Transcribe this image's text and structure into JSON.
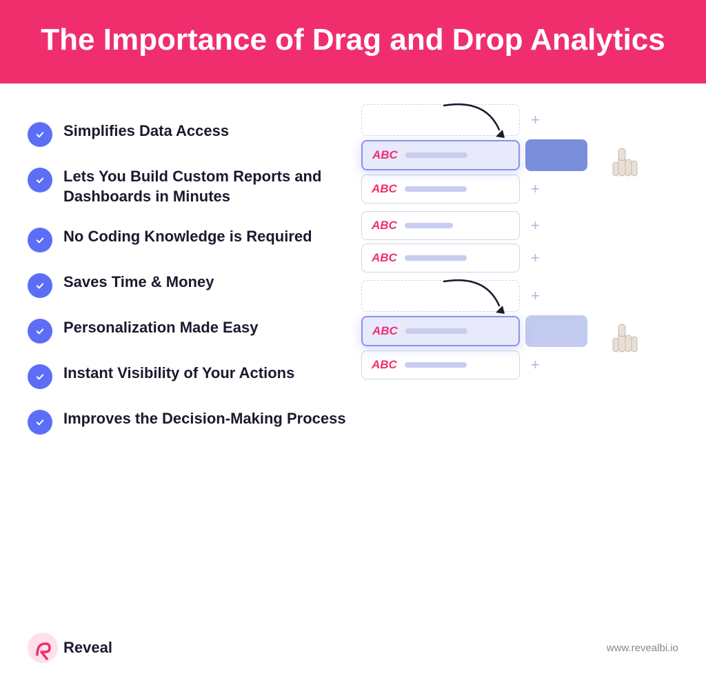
{
  "header": {
    "title": "The Importance of Drag and Drop Analytics"
  },
  "checklist": {
    "items": [
      {
        "id": "item1",
        "text": "Simplifies Data Access"
      },
      {
        "id": "item2",
        "text": "Lets You Build Custom Reports and Dashboards in Minutes"
      },
      {
        "id": "item3",
        "text": "No Coding Knowledge is Required"
      },
      {
        "id": "item4",
        "text": "Saves Time & Money"
      },
      {
        "id": "item5",
        "text": "Personalization Made Easy"
      },
      {
        "id": "item6",
        "text": "Instant Visibility of Your Actions"
      },
      {
        "id": "item7",
        "text": "Improves the Decision-Making Process"
      }
    ]
  },
  "illustration": {
    "abc_label": "ABC",
    "rows": [
      {
        "id": "r1",
        "bar": "long",
        "type": "normal"
      },
      {
        "id": "r2",
        "bar": "medium",
        "type": "dragged"
      },
      {
        "id": "r3",
        "bar": "long",
        "type": "normal"
      },
      {
        "id": "r4",
        "bar": "medium",
        "type": "normal"
      },
      {
        "id": "r5",
        "bar": "long",
        "type": "normal"
      },
      {
        "id": "r6",
        "bar": "medium",
        "type": "dragged"
      },
      {
        "id": "r7",
        "bar": "long",
        "type": "normal"
      }
    ]
  },
  "footer": {
    "logo_text": "Reveal",
    "website": "www.revealbi.io"
  }
}
